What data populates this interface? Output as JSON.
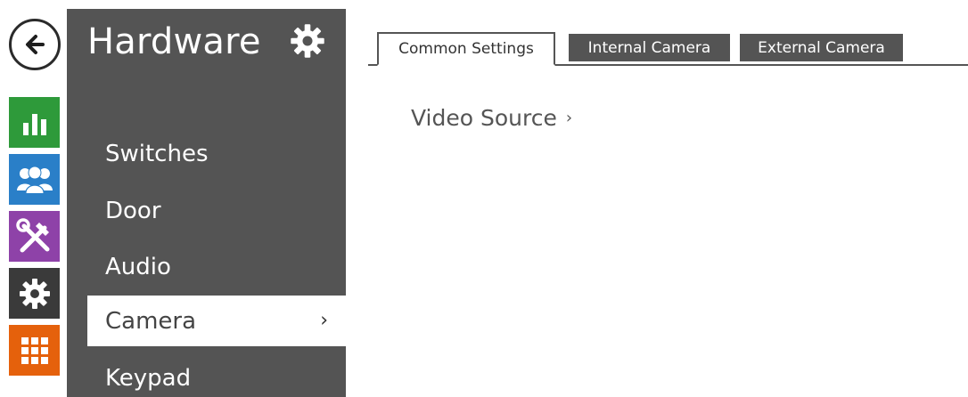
{
  "nav": {
    "back_icon": "arrow-left-icon",
    "rail": [
      {
        "name": "status",
        "icon": "bar-chart-icon",
        "color": "#2e9a3a"
      },
      {
        "name": "users",
        "icon": "users-icon",
        "color": "#2a7fc8"
      },
      {
        "name": "services",
        "icon": "tools-icon",
        "color": "#8e42a8"
      },
      {
        "name": "hardware",
        "icon": "gear-icon",
        "color": "#3a3a3a"
      },
      {
        "name": "system",
        "icon": "grid-icon",
        "color": "#e5610c"
      }
    ]
  },
  "sidebar": {
    "title": "Hardware",
    "title_icon": "gear-icon",
    "items": [
      {
        "label": "Switches"
      },
      {
        "label": "Door"
      },
      {
        "label": "Audio"
      },
      {
        "label": "Camera",
        "active": true,
        "chevron": "›"
      },
      {
        "label": "Keypad"
      }
    ]
  },
  "tabs": [
    {
      "label": "Common Settings",
      "active": true
    },
    {
      "label": "Internal Camera"
    },
    {
      "label": "External Camera"
    }
  ],
  "content": {
    "link_label": "Video Source",
    "link_chevron": "›"
  },
  "colors": {
    "sidebar_bg": "#545454",
    "active_item_bg": "#ffffff"
  }
}
